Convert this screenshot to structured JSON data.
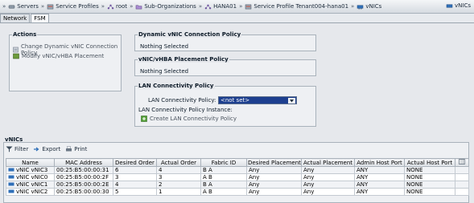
{
  "breadcrumb": [
    {
      "label": "Servers",
      "icon": "servers-icon"
    },
    {
      "label": "Service Profiles",
      "icon": "service-profiles-icon"
    },
    {
      "label": "root",
      "icon": "org-icon"
    },
    {
      "label": "Sub-Organizations",
      "icon": "folder-icon"
    },
    {
      "label": "HANA01",
      "icon": "org-icon"
    },
    {
      "label": "Service Profile Tenant004-hana01",
      "icon": "service-profile-icon"
    },
    {
      "label": "vNICs",
      "icon": "vnic-icon"
    }
  ],
  "window_title": "vNICs",
  "tabs": [
    {
      "label": "Network",
      "active": false
    },
    {
      "label": "FSM",
      "active": true
    }
  ],
  "actions": {
    "title": "Actions",
    "items": [
      {
        "label": "Change Dynamic vNIC Connection Policy",
        "icon": "policy-icon"
      },
      {
        "label": "Modify vNIC/vHBA Placement",
        "icon": "placement-icon"
      }
    ]
  },
  "dynamic_policy": {
    "title": "Dynamic vNIC Connection Policy",
    "value": "Nothing Selected"
  },
  "placement_policy": {
    "title": "vNIC/vHBA Placement Policy",
    "value": "Nothing Selected"
  },
  "lan_policy": {
    "title": "LAN Connectivity Policy",
    "field_label": "LAN Connectivity Policy:",
    "field_value": "<not set>",
    "instance_label": "LAN Connectivity Policy Instance:",
    "create_label": "Create LAN Connectivity Policy"
  },
  "vnics": {
    "title": "vNICs",
    "toolbar": {
      "filter": "Filter",
      "export": "Export",
      "print": "Print"
    },
    "columns": [
      "Name",
      "MAC Address",
      "Desired Order",
      "Actual Order",
      "Fabric ID",
      "Desired Placement",
      "Actual Placement",
      "Admin Host Port",
      "Actual Host Port"
    ],
    "rows": [
      [
        "vNIC vNIC3",
        "00:25:B5:00:00:31",
        "6",
        "4",
        "B A",
        "Any",
        "Any",
        "ANY",
        "NONE"
      ],
      [
        "vNIC vNIC0",
        "00:25:B5:00:00:2F",
        "3",
        "3",
        "A B",
        "Any",
        "Any",
        "ANY",
        "NONE"
      ],
      [
        "vNIC vNIC1",
        "00:25:B5:00:00:2E",
        "4",
        "2",
        "B A",
        "Any",
        "Any",
        "ANY",
        "NONE"
      ],
      [
        "vNIC vNIC2",
        "00:25:B5:00:00:30",
        "5",
        "1",
        "A B",
        "Any",
        "Any",
        "ANY",
        "NONE"
      ]
    ]
  }
}
